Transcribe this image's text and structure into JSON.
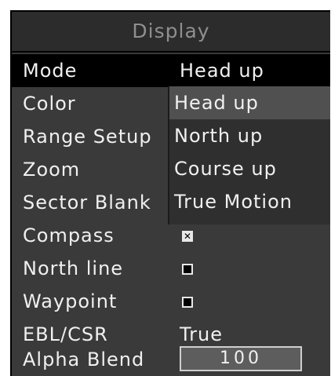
{
  "window": {
    "title": "Display"
  },
  "rows": [
    {
      "label": "Mode",
      "value": "Head up"
    },
    {
      "label": "Color"
    },
    {
      "label": "Range Setup"
    },
    {
      "label": "Zoom"
    },
    {
      "label": "Sector Blank"
    },
    {
      "label": "Compass",
      "checkbox": "checked"
    },
    {
      "label": "North line",
      "checkbox": "filled"
    },
    {
      "label": "Waypoint",
      "checkbox": "filled"
    },
    {
      "label": "EBL/CSR",
      "value": "True"
    },
    {
      "label": "Alpha Blend",
      "value": "100"
    }
  ],
  "mode_dropdown": {
    "options": [
      "Head up",
      "North up",
      "Course up",
      "True Motion"
    ],
    "highlighted": "Head up"
  },
  "colors": {
    "panel": "#3a3a3a",
    "selected_row": "#000000",
    "text": "#f0f0f0",
    "title": "#8f8f8f"
  }
}
